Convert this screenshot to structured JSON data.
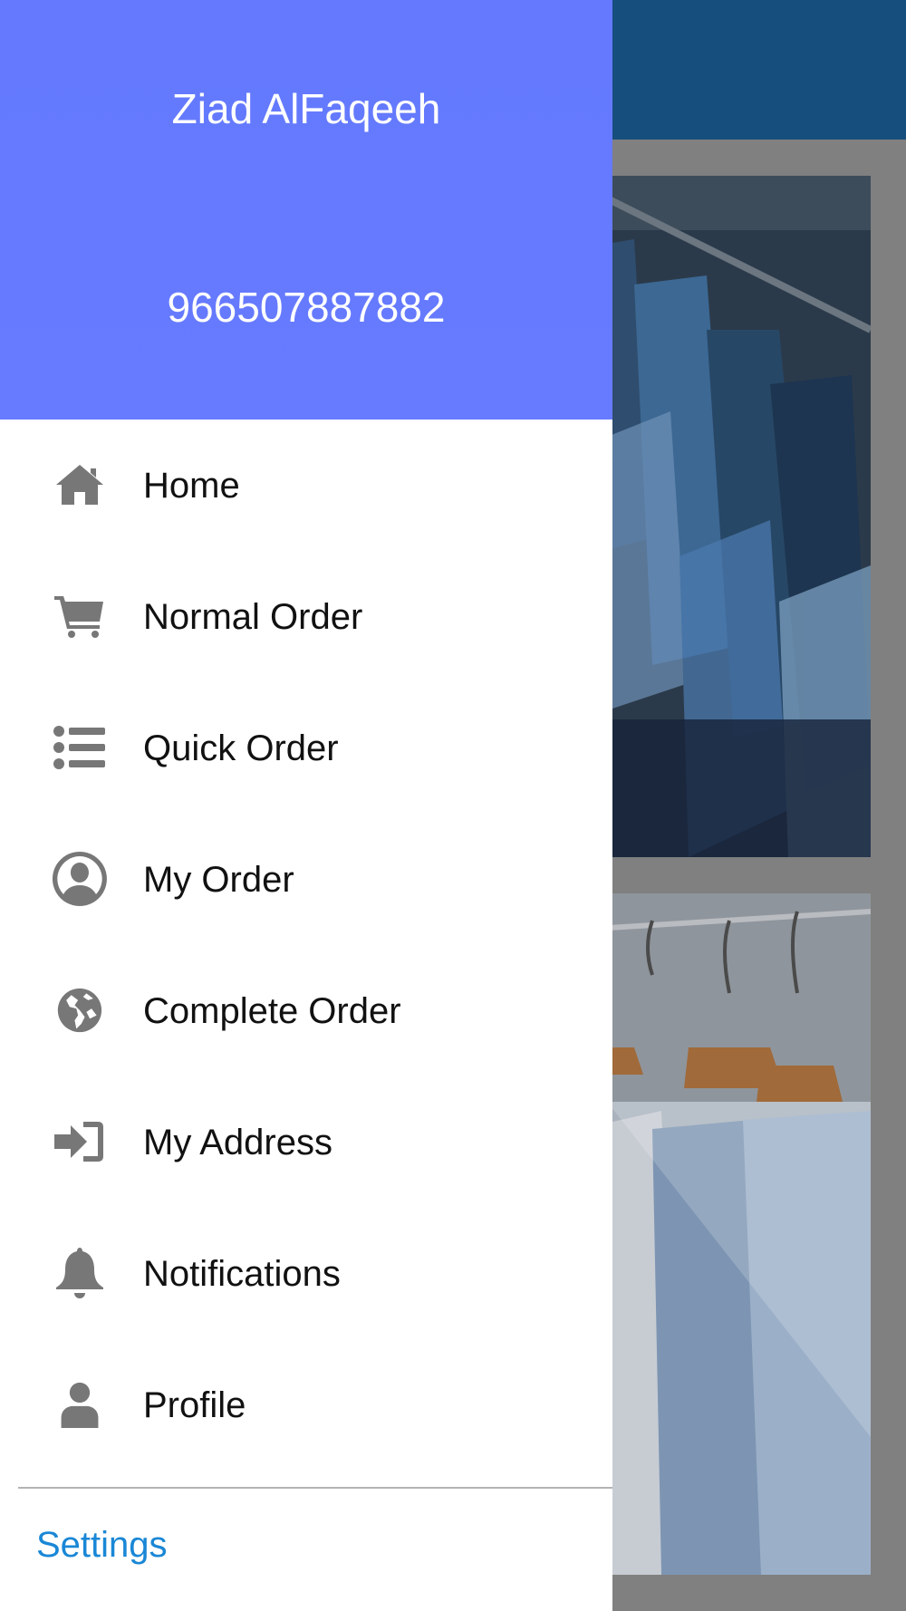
{
  "drawer": {
    "user_name": "Ziad AlFaqeeh",
    "phone": "966507887882",
    "header_color": "#657aff",
    "items": [
      {
        "label": "Home",
        "icon": "home-icon"
      },
      {
        "label": "Normal Order",
        "icon": "cart-icon"
      },
      {
        "label": "Quick Order",
        "icon": "list-icon"
      },
      {
        "label": "My Order",
        "icon": "user-circle-icon"
      },
      {
        "label": "Complete Order",
        "icon": "globe-icon"
      },
      {
        "label": "My Address",
        "icon": "sign-in-icon"
      },
      {
        "label": "Notifications",
        "icon": "bell-icon"
      },
      {
        "label": "Profile",
        "icon": "user-icon"
      }
    ],
    "settings_label": "Settings"
  },
  "background": {
    "topbar_color": "#164e7d",
    "cards": [
      "shirts-on-hangers-image",
      "garments-in-dry-cleaning-bags-image"
    ]
  }
}
